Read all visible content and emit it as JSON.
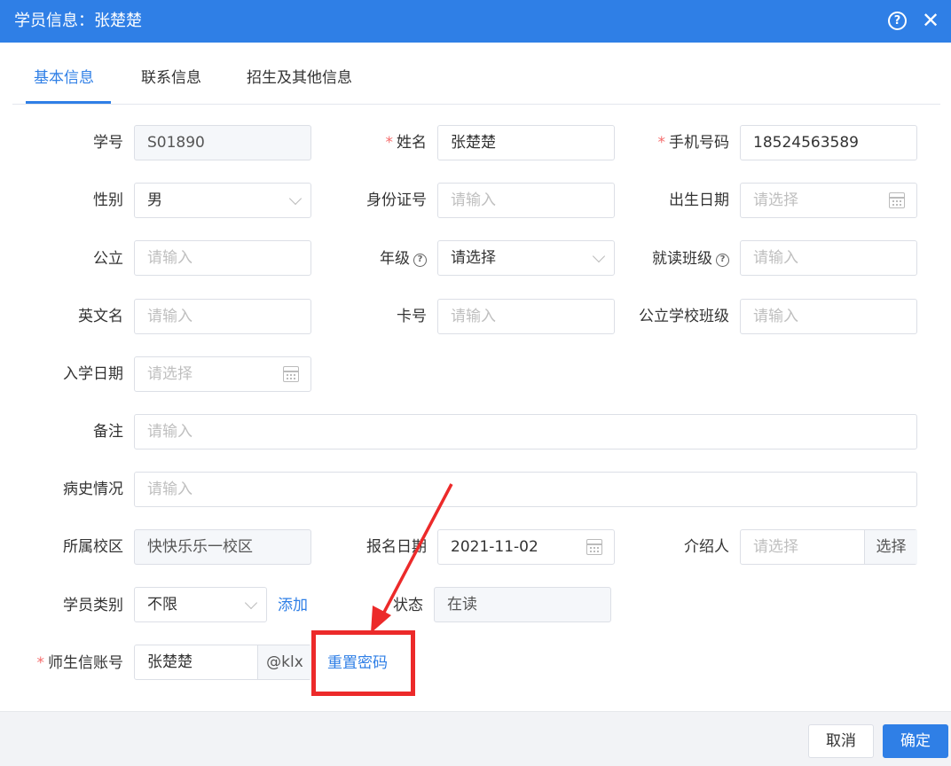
{
  "window": {
    "title": "学员信息：张楚楚",
    "help_label": "?",
    "close_label": "✕"
  },
  "tabs": [
    {
      "label": "基本信息"
    },
    {
      "label": "联系信息"
    },
    {
      "label": "招生及其他信息"
    }
  ],
  "form": {
    "student_id": {
      "label": "学号",
      "value": "S01890"
    },
    "name": {
      "label": "姓名",
      "value": "张楚楚"
    },
    "phone": {
      "label": "手机号码",
      "value": "18524563589"
    },
    "gender": {
      "label": "性别",
      "value": "男"
    },
    "id_number": {
      "label": "身份证号",
      "placeholder": "请输入"
    },
    "birth_date": {
      "label": "出生日期",
      "placeholder": "请选择"
    },
    "public_school": {
      "label": "公立",
      "placeholder": "请输入"
    },
    "grade": {
      "label": "年级",
      "value": "请选择"
    },
    "class": {
      "label": "就读班级",
      "placeholder": "请输入"
    },
    "english_name": {
      "label": "英文名",
      "placeholder": "请输入"
    },
    "card_number": {
      "label": "卡号",
      "placeholder": "请输入"
    },
    "public_school_class": {
      "label": "公立学校班级",
      "placeholder": "请输入"
    },
    "enroll_date": {
      "label": "入学日期",
      "placeholder": "请选择"
    },
    "remarks": {
      "label": "备注",
      "placeholder": "请输入"
    },
    "medical_history": {
      "label": "病史情况",
      "placeholder": "请输入"
    },
    "campus": {
      "label": "所属校区",
      "value": "快快乐乐一校区"
    },
    "signup_date": {
      "label": "报名日期",
      "value": "2021-11-02"
    },
    "referrer": {
      "label": "介绍人",
      "placeholder": "请选择",
      "button_label": "选择"
    },
    "student_type": {
      "label": "学员类别",
      "value": "不限",
      "add_label": "添加"
    },
    "status": {
      "label": "状态",
      "value": "在读"
    },
    "account": {
      "label": "师生信账号",
      "value": "张楚楚",
      "suffix": "@klx",
      "reset_label": "重置密码"
    }
  },
  "footer": {
    "cancel_label": "取消",
    "ok_label": "确定"
  },
  "colors": {
    "primary": "#2f7fe6",
    "required": "#f56c6c",
    "annotation": "#ec2a2a"
  }
}
